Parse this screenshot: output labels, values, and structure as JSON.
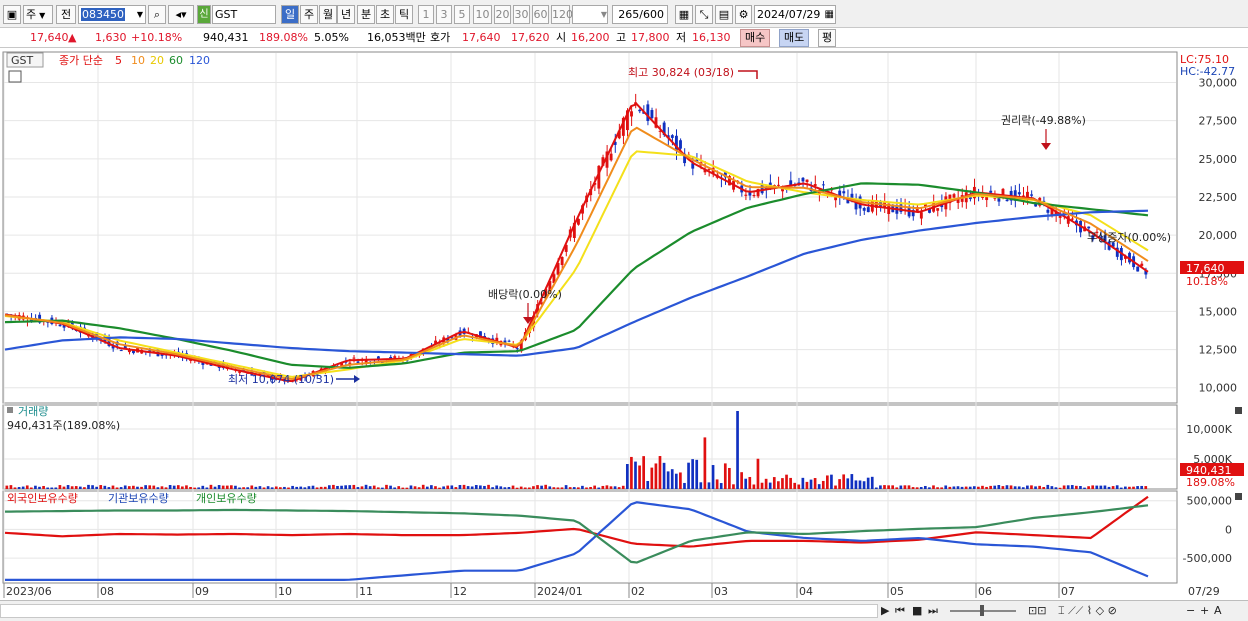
{
  "toolbar": {
    "mode_a": "주",
    "mode_b": "전",
    "stock_code": "083450",
    "badge_new": "신",
    "stock_name": "GST",
    "periods": [
      "일",
      "주",
      "월",
      "년",
      "분",
      "초",
      "틱"
    ],
    "intervals": [
      "1",
      "3",
      "5",
      "10",
      "20",
      "30",
      "60",
      "120"
    ],
    "count": "265",
    "count_max": "/600",
    "date": "2024/07/29"
  },
  "quote": {
    "price": "17,640",
    "up_arrow": "▲",
    "change": "1,630",
    "change_pct": "+10.18%",
    "volume": "940,431",
    "volume_ratio": "189.08%",
    "turnover": "5.05%",
    "amount": "16,053백만",
    "hoga_label": "호가",
    "ask": "17,640",
    "bid": "17,620",
    "open_label": "시",
    "open": "16,200",
    "high_label": "고",
    "high": "17,800",
    "low_label": "저",
    "low": "16,130",
    "buy_button": "매수",
    "sell_button": "매도",
    "pyeong_button": "평"
  },
  "price_panel": {
    "legend_name": "GST",
    "legend_series_label": "종가 단순",
    "ma_periods": [
      "5",
      "10",
      "20",
      "60",
      "120"
    ],
    "lc": "LC:75.10",
    "hc": "HC:-42.77",
    "high_annotation": "최고 30,824 (03/18)",
    "low_annotation": "최저 10,074 (10/31)",
    "dividend_annotation": "배당락(0.00%)",
    "rights_annotation": "권리락(-49.88%)",
    "bonus_annotation": "무상증자(0.00%)",
    "price_tag": "17,640",
    "change_tag": "10.18%",
    "y_ticks": [
      "30,000",
      "27,500",
      "25,000",
      "22,500",
      "20,000",
      "17,500",
      "15,000",
      "12,500",
      "10,000"
    ]
  },
  "volume_panel": {
    "title": "거래량",
    "current": "940,431주(189.08%)",
    "y_ticks": [
      "10,000K",
      "5,000K"
    ],
    "value_tag": "940,431",
    "pct_tag": "189.08%"
  },
  "holding_panel": {
    "legend": [
      "외국인보유수량",
      "기관보유수량",
      "개인보유수량"
    ],
    "y_ticks": [
      "500,000",
      "0",
      "-500,000"
    ]
  },
  "x_axis": {
    "labels": [
      "2023/06",
      "08",
      "09",
      "10",
      "11",
      "12",
      "2024/01",
      "02",
      "03",
      "04",
      "05",
      "06",
      "07",
      "07/29"
    ]
  },
  "colors": {
    "ma5": "#e01010",
    "ma10": "#f08c1c",
    "ma20": "#f4e01a",
    "ma60": "#1b8c2c",
    "ma120": "#2a56d6",
    "up": "#e01010",
    "down": "#1030c0"
  },
  "chart_data": [
    {
      "type": "line",
      "title": "",
      "series": [
        {
          "name": "5",
          "values": [
            14800,
            14200,
            12600,
            12100,
            11200,
            10400,
            11800,
            11900,
            13700,
            12600,
            21000,
            28800,
            24800,
            22800,
            23400,
            22000,
            21500,
            22800,
            22400,
            20200,
            17600
          ]
        },
        {
          "name": "20",
          "values": [
            14700,
            14300,
            13100,
            12300,
            11500,
            10700,
            11200,
            11800,
            13200,
            12800,
            17800,
            25500,
            25200,
            23500,
            22800,
            22300,
            22000,
            22600,
            22300,
            21300,
            19000
          ]
        },
        {
          "name": "60",
          "values": [
            14300,
            14400,
            13900,
            13200,
            12400,
            11500,
            11300,
            11600,
            12300,
            12400,
            13800,
            17800,
            20200,
            21800,
            22700,
            23400,
            23300,
            22800,
            22100,
            21700,
            21300
          ]
        },
        {
          "name": "120",
          "values": [
            12500,
            13100,
            13300,
            13200,
            12900,
            12600,
            12400,
            12300,
            12200,
            12100,
            12600,
            14300,
            15900,
            17300,
            18800,
            19700,
            20300,
            20800,
            21200,
            21500,
            21600
          ]
        }
      ],
      "ylim": [
        9000,
        32000
      ]
    },
    {
      "type": "bar",
      "title": "거래량",
      "ylim": [
        0,
        14000000
      ]
    },
    {
      "type": "line",
      "series": [
        {
          "name": "외국인보유수량",
          "values": [
            -60000,
            -120000,
            -80000,
            -90000,
            -80000,
            -100000,
            -80000,
            -100000,
            -100000,
            -60000,
            10000,
            -250000,
            -300000,
            -200000,
            -200000,
            -230000,
            -180000,
            -50000,
            -100000,
            -150000,
            570000
          ]
        },
        {
          "name": "기관보유수량",
          "values": [
            -880000,
            -880000,
            -880000,
            -880000,
            -880000,
            -880000,
            -880000,
            -800000,
            -720000,
            -720000,
            -420000,
            480000,
            350000,
            -40000,
            -150000,
            -200000,
            -150000,
            -260000,
            -300000,
            -400000,
            -820000
          ]
        },
        {
          "name": "개인보유수량",
          "values": [
            310000,
            320000,
            330000,
            330000,
            340000,
            330000,
            320000,
            300000,
            280000,
            240000,
            150000,
            -600000,
            -200000,
            -50000,
            -80000,
            -30000,
            10000,
            40000,
            200000,
            300000,
            420000
          ]
        }
      ],
      "ylim": [
        -900000,
        600000
      ]
    }
  ]
}
